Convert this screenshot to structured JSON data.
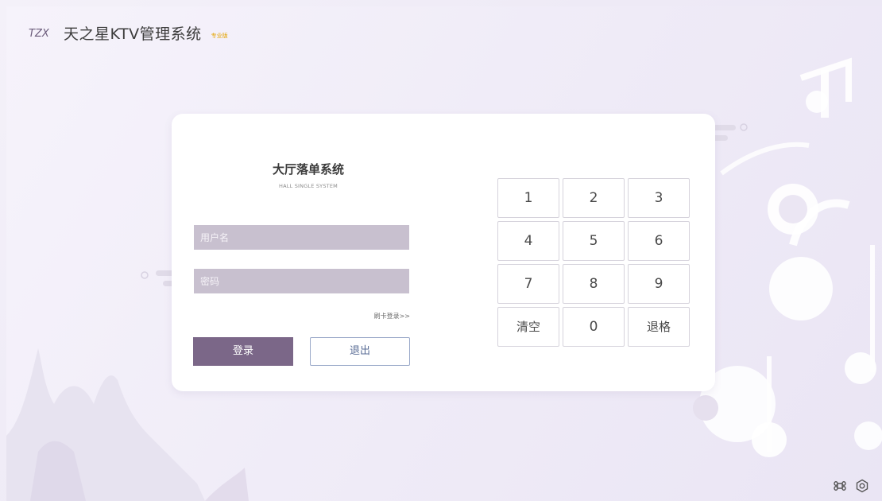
{
  "header": {
    "logo_text": "TZX",
    "app_title": "天之星KTV管理系统",
    "edition": "专业版"
  },
  "login": {
    "title": "大厅落单系统",
    "subtitle": "HALL SINGLE SYSTEM",
    "username_placeholder": "用户名",
    "password_placeholder": "密码",
    "swipe_login": "刷卡登录>>",
    "login_button": "登录",
    "exit_button": "退出"
  },
  "keypad": {
    "keys": [
      "1",
      "2",
      "3",
      "4",
      "5",
      "6",
      "7",
      "8",
      "9",
      "清空",
      "0",
      "退格"
    ]
  },
  "footer": {
    "icons": [
      "command-icon",
      "settings-icon"
    ]
  }
}
